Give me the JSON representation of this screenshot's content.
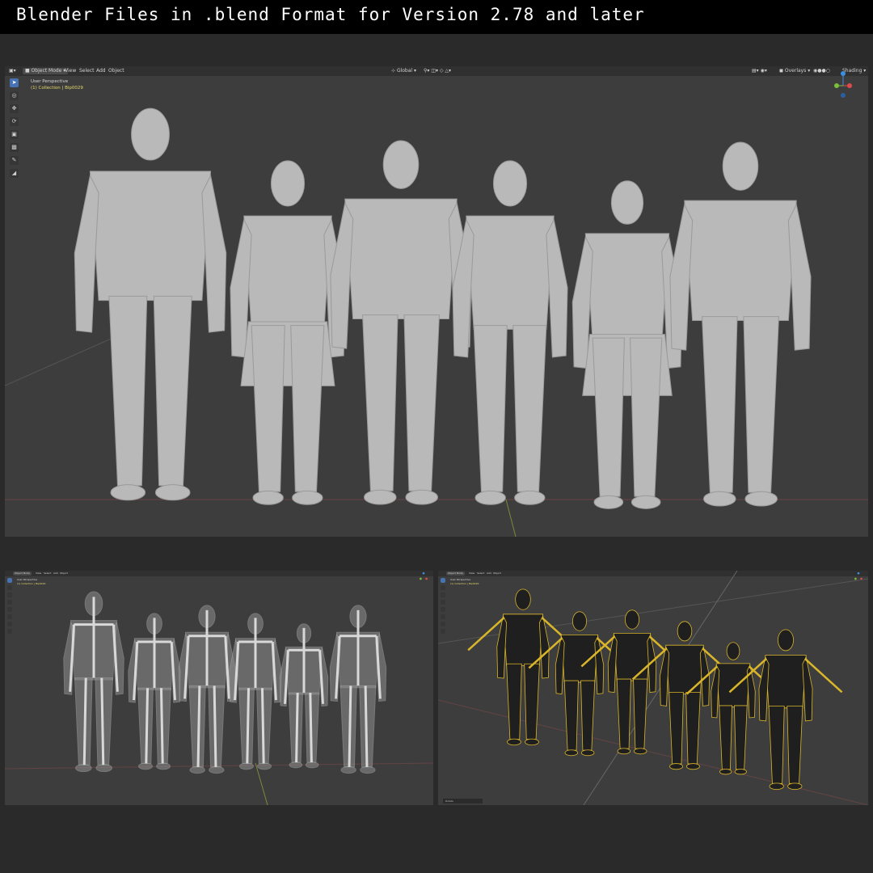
{
  "banner": {
    "title": "Blender Files in .blend Format for Version 2.78 and later"
  },
  "main_viewport": {
    "header": {
      "editor_icon": "3d-viewport-icon",
      "mode": "Object Mode",
      "menus": [
        "View",
        "Select",
        "Add",
        "Object"
      ],
      "transform_orientation": "Global",
      "overlays": "Overlays",
      "shading": "Shading"
    },
    "overlay": {
      "view_name": "User Perspective",
      "collection": "(1) Collection | Bip0029"
    }
  },
  "armature_viewport": {
    "header": {
      "mode": "Object Mode",
      "menus": [
        "View",
        "Select",
        "Add",
        "Object"
      ]
    },
    "overlay": {
      "view_name": "User Perspective",
      "collection": "(1) Collection | Bip0029"
    }
  },
  "wireframe_viewport": {
    "header": {
      "mode": "Object Mode",
      "menus": [
        "View",
        "Select",
        "Add",
        "Object"
      ]
    },
    "overlay": {
      "view_name": "User Perspective",
      "collection": "(1) Collection | Bip0029"
    },
    "status": "Rotate"
  },
  "toolbar_tools": [
    "select-box-icon",
    "cursor-icon",
    "move-icon",
    "rotate-icon",
    "scale-icon",
    "transform-icon",
    "annotate-icon",
    "measure-icon"
  ],
  "colors": {
    "viewport_bg": "#3d3d3d",
    "header_bg": "#303030",
    "active_tool": "#4772b3",
    "collection_text": "#e3d96b",
    "wire_color": "#d9b52a",
    "gizmo_x": "#e04a4a",
    "gizmo_y": "#7cbf3a",
    "gizmo_z": "#3d8ee0"
  }
}
